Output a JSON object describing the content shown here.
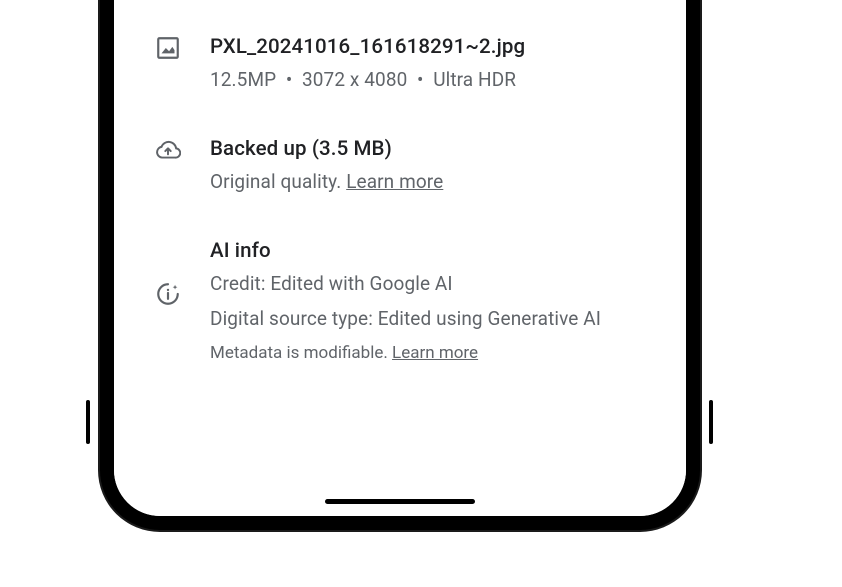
{
  "file": {
    "filename": "PXL_20241016_161618291~2.jpg",
    "megapixels": "12.5MP",
    "dimensions": "3072 x 4080",
    "format": "Ultra HDR"
  },
  "backup": {
    "title": "Backed up (3.5 MB)",
    "quality": "Original quality.",
    "learn_more": "Learn more"
  },
  "ai_info": {
    "title": "AI info",
    "credit": "Credit: Edited with Google AI",
    "source_type": "Digital source type: Edited using Generative AI",
    "metadata_note": "Metadata is modifiable.",
    "learn_more": "Learn more"
  }
}
